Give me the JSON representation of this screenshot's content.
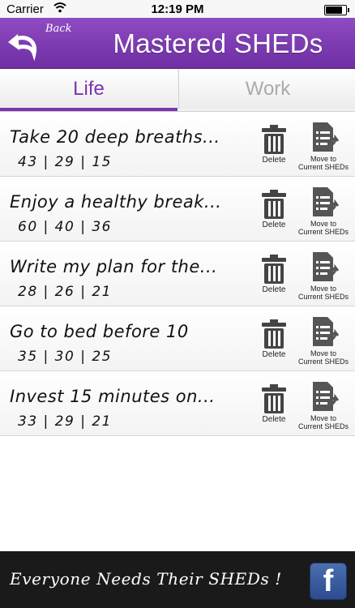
{
  "status_bar": {
    "carrier": "Carrier",
    "time": "12:19 PM",
    "battery_level": 0.9
  },
  "header": {
    "back_label": "Back",
    "title": "Mastered SHEDs",
    "background_color": "#7b38ad"
  },
  "tabs": [
    {
      "label": "Life",
      "selected": true
    },
    {
      "label": "Work",
      "selected": false
    }
  ],
  "items": [
    {
      "title": "Take 20 deep breaths...",
      "stats": "43 | 29 | 15",
      "delete_label": "Delete",
      "move_label_1": "Move to",
      "move_label_2": "Current SHEDs"
    },
    {
      "title": "Enjoy a healthy break...",
      "stats": "60 | 40 | 36",
      "delete_label": "Delete",
      "move_label_1": "Move to",
      "move_label_2": "Current SHEDs"
    },
    {
      "title": "Write my plan for the...",
      "stats": "28 | 26 | 21",
      "delete_label": "Delete",
      "move_label_1": "Move to",
      "move_label_2": "Current SHEDs"
    },
    {
      "title": "Go to bed before 10",
      "stats": "35 | 30 | 25",
      "delete_label": "Delete",
      "move_label_1": "Move to",
      "move_label_2": "Current SHEDs"
    },
    {
      "title": "Invest 15 minutes on...",
      "stats": "33 | 29 | 21",
      "delete_label": "Delete",
      "move_label_1": "Move to",
      "move_label_2": "Current SHEDs"
    }
  ],
  "footer": {
    "tagline": "Everyone Needs Their SHEDs !",
    "facebook_glyph": "f"
  },
  "icons": {
    "back": "back-arrow-icon",
    "delete": "trash-icon",
    "move": "document-arrow-icon",
    "facebook": "facebook-icon"
  }
}
